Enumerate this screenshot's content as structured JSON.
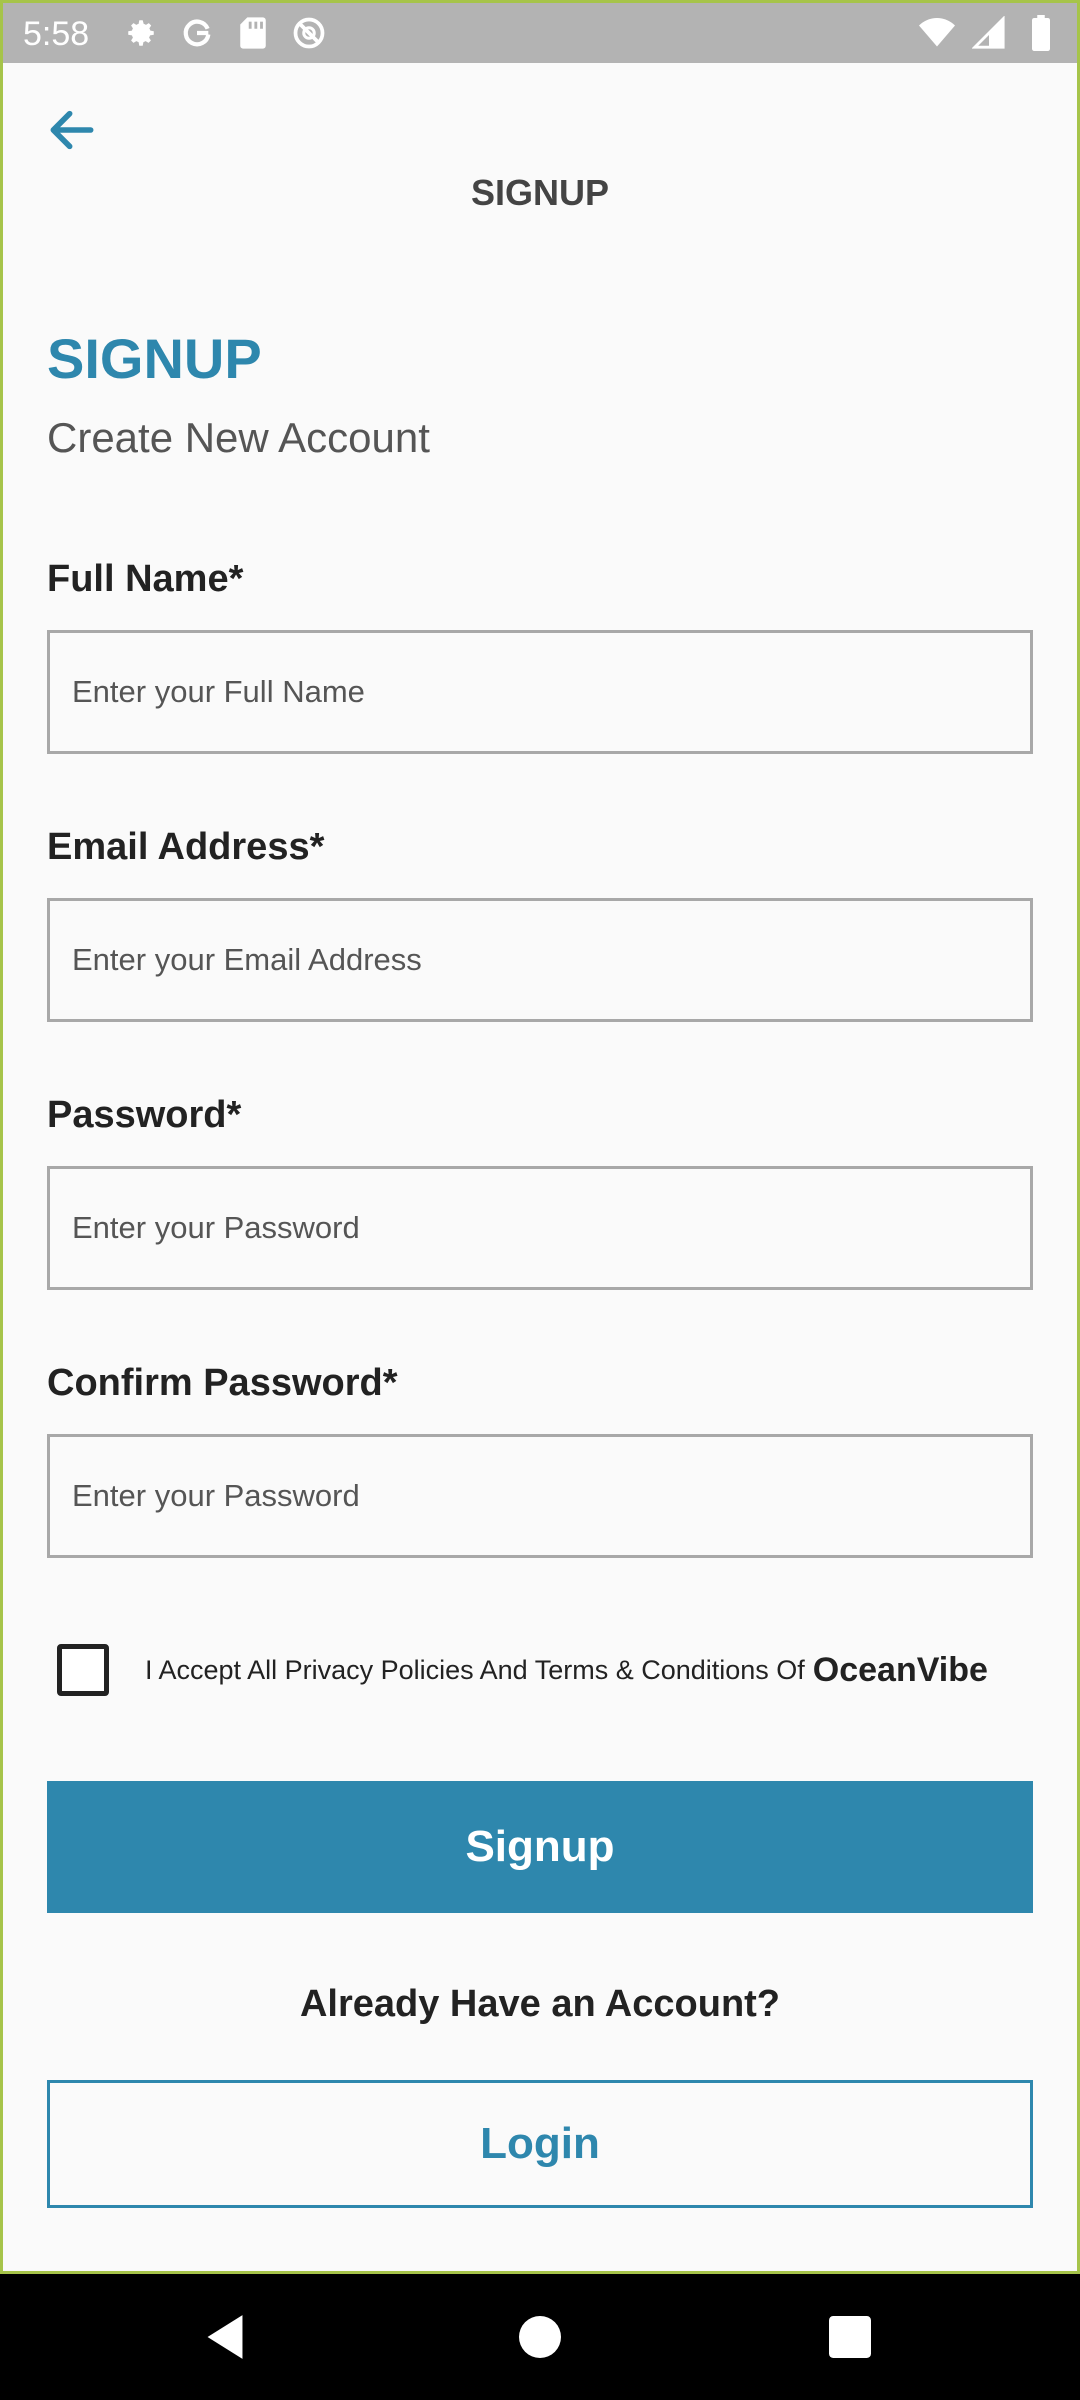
{
  "status_bar": {
    "time": "5:58",
    "left_icons": [
      "settings-icon",
      "google-icon",
      "sd-card-icon",
      "do-not-disturb-icon"
    ],
    "right_icons": [
      "wifi-icon",
      "signal-icon",
      "battery-icon"
    ]
  },
  "app_bar": {
    "title": "SIGNUP",
    "back_icon": "arrow-back-icon"
  },
  "page": {
    "heading": "SIGNUP",
    "subheading": "Create New Account"
  },
  "form": {
    "full_name": {
      "label": "Full Name*",
      "placeholder": "Enter your Full Name",
      "value": ""
    },
    "email": {
      "label": "Email Address*",
      "placeholder": "Enter your Email Address",
      "value": ""
    },
    "password": {
      "label": "Password*",
      "placeholder": "Enter your Password",
      "value": ""
    },
    "confirm_password": {
      "label": "Confirm Password*",
      "placeholder": "Enter your Password",
      "value": ""
    },
    "terms": {
      "text": "I Accept All Privacy Policies And Terms & Conditions Of",
      "brand": "OceanVibe",
      "checked": false
    }
  },
  "actions": {
    "signup_label": "Signup",
    "already_text": "Already Have an Account?",
    "login_label": "Login"
  },
  "colors": {
    "accent": "#2e87ad",
    "background": "#fafafa",
    "status_bar": "#b3b3b3"
  },
  "nav_bar": {
    "icons": [
      "back-triangle-icon",
      "home-circle-icon",
      "recents-square-icon"
    ]
  }
}
